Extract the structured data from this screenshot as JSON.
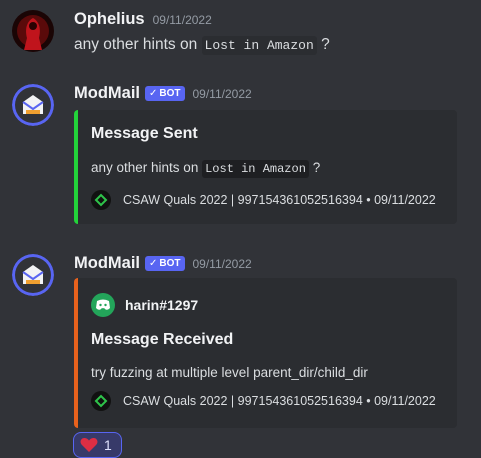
{
  "messages": [
    {
      "username": "Ophelius",
      "timestamp": "09/11/2022",
      "content_prefix": "any other hints on",
      "content_code": "Lost in Amazon",
      "content_suffix": "?"
    },
    {
      "username": "ModMail",
      "bot_label": "BOT",
      "timestamp": "09/11/2022",
      "embed": {
        "accent_color": "#23d33a",
        "title": "Message Sent",
        "desc_prefix": "any other hints on",
        "desc_code": "Lost in Amazon",
        "desc_suffix": "?",
        "footer": "CSAW Quals 2022 | 997154361052516394 • 09/11/2022"
      }
    },
    {
      "username": "ModMail",
      "bot_label": "BOT",
      "timestamp": "09/11/2022",
      "embed": {
        "accent_color": "#e8621d",
        "author": "harin#1297",
        "title": "Message Received",
        "description": "try fuzzing at multiple level parent_dir/child_dir",
        "footer": "CSAW Quals 2022 | 997154361052516394 • 09/11/2022"
      },
      "reaction": {
        "emoji": "heart-icon",
        "count": "1"
      }
    }
  ]
}
